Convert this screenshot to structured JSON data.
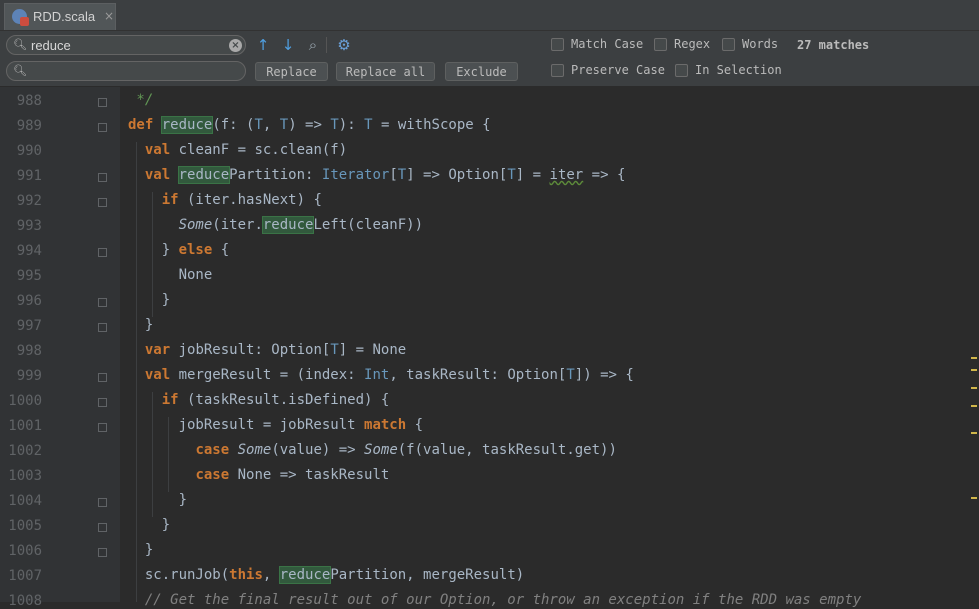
{
  "tab": {
    "filename": "RDD.scala",
    "close": "×"
  },
  "find": {
    "search_value": "reduce",
    "replace_value": "",
    "matches": "27 matches",
    "buttons": {
      "replace": "Replace",
      "replace_all": "Replace all",
      "exclude": "Exclude"
    },
    "options": {
      "match_case": "Match Case",
      "regex": "Regex",
      "words": "Words",
      "preserve_case": "Preserve Case",
      "in_selection": "In Selection"
    }
  },
  "code": {
    "line_numbers": [
      "988",
      "989",
      "990",
      "991",
      "992",
      "993",
      "994",
      "995",
      "996",
      "997",
      "998",
      "999",
      "1000",
      "1001",
      "1002",
      "1003",
      "1004",
      "1005",
      "1006",
      "1007",
      "1008"
    ],
    "lines": [
      " */",
      "def reduce(f: (T, T) => T): T = withScope {",
      "  val cleanF = sc.clean(f)",
      "  val reducePartition: Iterator[T] => Option[T] = iter => {",
      "    if (iter.hasNext) {",
      "      Some(iter.reduceLeft(cleanF))",
      "    } else {",
      "      None",
      "    }",
      "  }",
      "  var jobResult: Option[T] = None",
      "  val mergeResult = (index: Int, taskResult: Option[T]) => {",
      "    if (taskResult.isDefined) {",
      "      jobResult = jobResult match {",
      "        case Some(value) => Some(f(value, taskResult.get))",
      "        case None => taskResult",
      "      }",
      "    }",
      "  }",
      "  sc.runJob(this, reducePartition, mergeResult)",
      "  // Get the final result out of our Option, or throw an exception if the RDD was empty"
    ]
  }
}
